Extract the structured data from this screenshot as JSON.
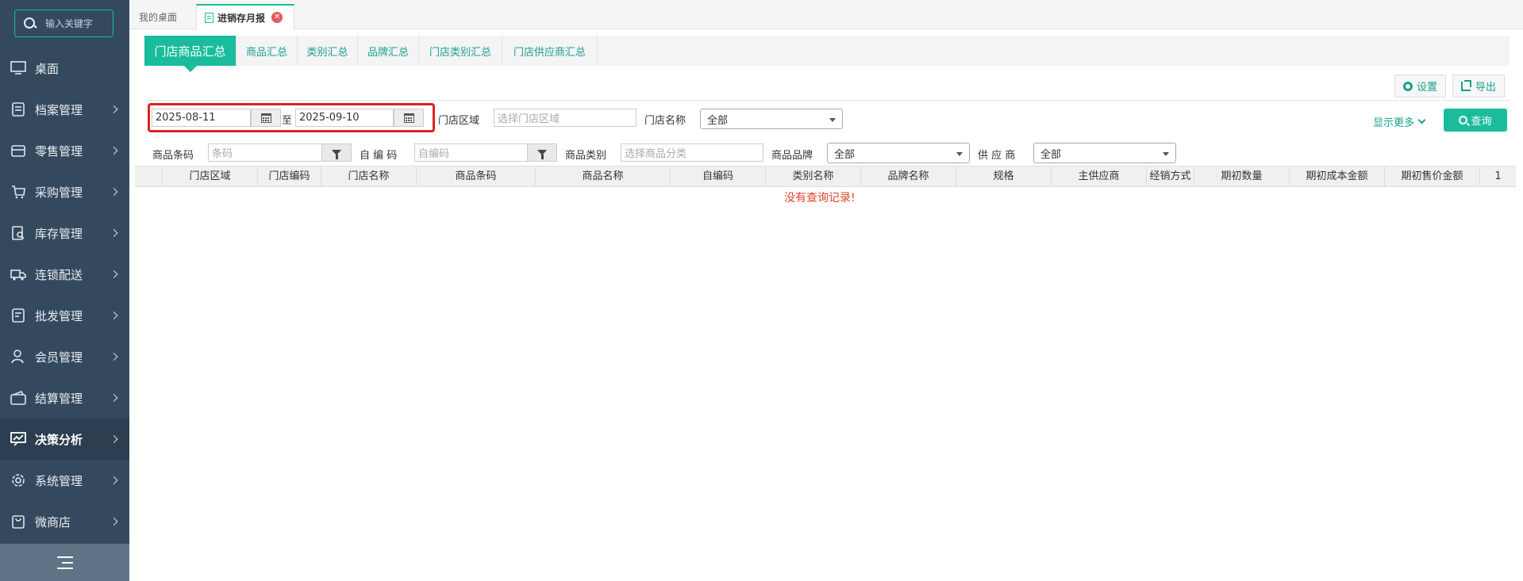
{
  "sidebar": {
    "search_placeholder": "输入关键字",
    "items": [
      {
        "label": "桌面",
        "icon": "monitor-icon"
      },
      {
        "label": "档案管理",
        "icon": "archive-icon"
      },
      {
        "label": "零售管理",
        "icon": "store-icon"
      },
      {
        "label": "采购管理",
        "icon": "cart-icon"
      },
      {
        "label": "库存管理",
        "icon": "inventory-icon"
      },
      {
        "label": "连锁配送",
        "icon": "truck-icon"
      },
      {
        "label": "批发管理",
        "icon": "wholesale-icon"
      },
      {
        "label": "会员管理",
        "icon": "user-icon"
      },
      {
        "label": "结算管理",
        "icon": "wallet-icon"
      },
      {
        "label": "决策分析",
        "icon": "chart-icon",
        "active": true
      },
      {
        "label": "系统管理",
        "icon": "gear-icon"
      },
      {
        "label": "微商店",
        "icon": "bag-icon"
      }
    ]
  },
  "tabs": {
    "home": "我的桌面",
    "active": "进销存月报"
  },
  "subtabs": [
    "门店商品汇总",
    "商品汇总",
    "类别汇总",
    "品牌汇总",
    "门店类别汇总",
    "门店供应商汇总"
  ],
  "toolbar": {
    "settings": "设置",
    "export": "导出"
  },
  "filters": {
    "date_from": "2025-08-11",
    "date_sep": "至",
    "date_to": "2025-09-10",
    "store_area_label": "门店区域",
    "store_area_placeholder": "选择门店区域",
    "store_name_label": "门店名称",
    "store_name_value": "全部",
    "barcode_label": "商品条码",
    "barcode_placeholder": "条码",
    "code_label": "自 编 码",
    "code_placeholder": "自编码",
    "category_label": "商品类别",
    "category_placeholder": "选择商品分类",
    "brand_label": "商品品牌",
    "brand_value": "全部",
    "supplier_label": "供 应 商",
    "supplier_value": "全部",
    "show_more": "显示更多",
    "query": "查询"
  },
  "table": {
    "columns": [
      "门店区域",
      "门店编码",
      "门店名称",
      "商品条码",
      "商品名称",
      "自编码",
      "类别名称",
      "品牌名称",
      "规格",
      "主供应商",
      "经销方式",
      "期初数量",
      "期初成本金额",
      "期初售价金额",
      "1"
    ],
    "empty_message": "没有查询记录!"
  }
}
